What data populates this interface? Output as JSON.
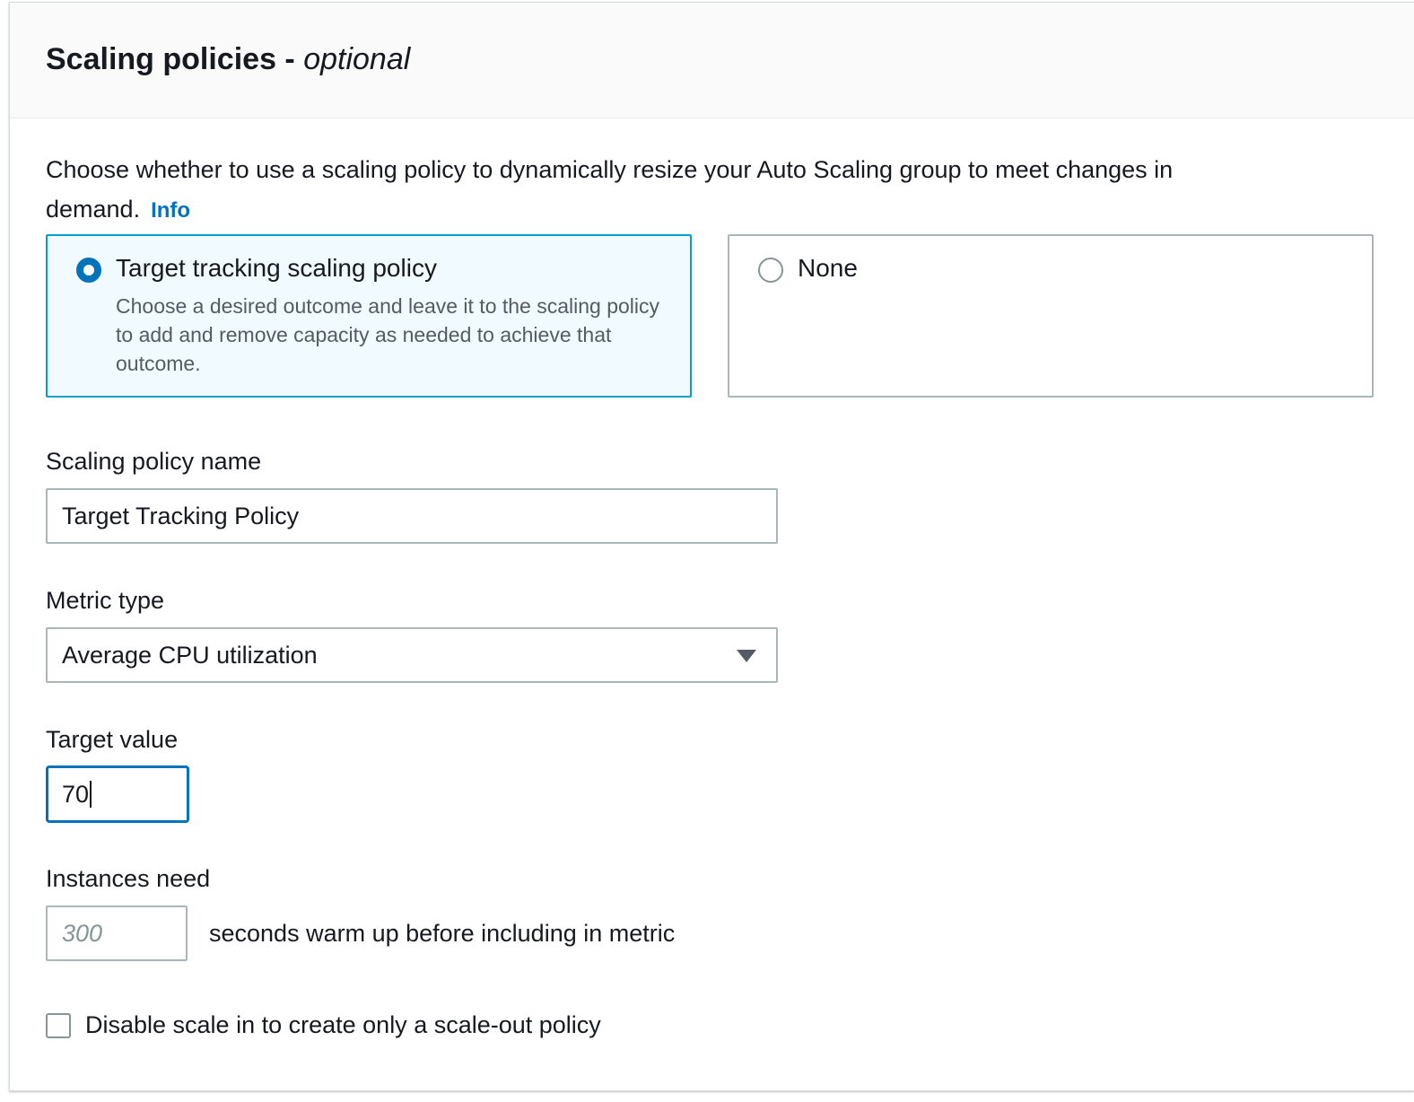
{
  "header": {
    "title": "Scaling policies -",
    "title_suffix": "optional"
  },
  "description": {
    "text": "Choose whether to use a scaling policy to dynamically resize your Auto Scaling group to meet changes in demand.",
    "info_link": "Info"
  },
  "policy_options": [
    {
      "label": "Target tracking scaling policy",
      "description": "Choose a desired outcome and leave it to the scaling policy to add and remove capacity as needed to achieve that outcome.",
      "selected": true
    },
    {
      "label": "None",
      "selected": false
    }
  ],
  "fields": {
    "policy_name": {
      "label": "Scaling policy name",
      "value": "Target Tracking Policy"
    },
    "metric_type": {
      "label": "Metric type",
      "value": "Average CPU utilization"
    },
    "target_value": {
      "label": "Target value",
      "value": "70"
    },
    "instances_need": {
      "label": "Instances need",
      "placeholder": "300",
      "suffix": "seconds warm up before including in metric"
    },
    "disable_scale_in": {
      "label": "Disable scale in to create only a scale-out policy",
      "checked": false
    }
  },
  "colors": {
    "accent": "#0073bb",
    "selected_tile_border": "#00a1c9",
    "selected_tile_bg": "#f1faff",
    "border": "#aab7b8",
    "text": "#16191f",
    "secondary_text": "#545b64"
  }
}
